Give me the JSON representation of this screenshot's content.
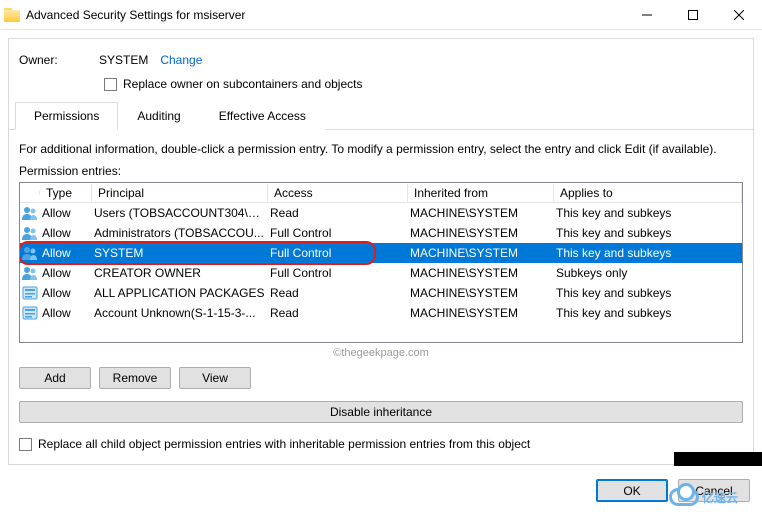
{
  "window": {
    "title": "Advanced Security Settings for msiserver"
  },
  "owner": {
    "label": "Owner:",
    "value": "SYSTEM",
    "change": "Change",
    "replace_checkbox_label": "Replace owner on subcontainers and objects"
  },
  "tabs": {
    "permissions": "Permissions",
    "auditing": "Auditing",
    "effective": "Effective Access"
  },
  "info_text": "For additional information, double-click a permission entry. To modify a permission entry, select the entry and click Edit (if available).",
  "entries_label": "Permission entries:",
  "columns": {
    "type": "Type",
    "principal": "Principal",
    "access": "Access",
    "inherited": "Inherited from",
    "applies": "Applies to"
  },
  "rows": [
    {
      "icon": "users",
      "type": "Allow",
      "principal": "Users (TOBSACCOUNT304\\Us...",
      "access": "Read",
      "inherited": "MACHINE\\SYSTEM",
      "applies": "This key and subkeys",
      "selected": false
    },
    {
      "icon": "users",
      "type": "Allow",
      "principal": "Administrators (TOBSACCOU...",
      "access": "Full Control",
      "inherited": "MACHINE\\SYSTEM",
      "applies": "This key and subkeys",
      "selected": false
    },
    {
      "icon": "users",
      "type": "Allow",
      "principal": "SYSTEM",
      "access": "Full Control",
      "inherited": "MACHINE\\SYSTEM",
      "applies": "This key and subkeys",
      "selected": true,
      "highlight": true
    },
    {
      "icon": "users",
      "type": "Allow",
      "principal": "CREATOR OWNER",
      "access": "Full Control",
      "inherited": "MACHINE\\SYSTEM",
      "applies": "Subkeys only",
      "selected": false
    },
    {
      "icon": "package",
      "type": "Allow",
      "principal": "ALL APPLICATION PACKAGES",
      "access": "Read",
      "inherited": "MACHINE\\SYSTEM",
      "applies": "This key and subkeys",
      "selected": false
    },
    {
      "icon": "package",
      "type": "Allow",
      "principal": "Account Unknown(S-1-15-3-...",
      "access": "Read",
      "inherited": "MACHINE\\SYSTEM",
      "applies": "This key and subkeys",
      "selected": false
    }
  ],
  "watermark": "©thegeekpage.com",
  "buttons": {
    "add": "Add",
    "remove": "Remove",
    "view": "View",
    "disable_inheritance": "Disable inheritance",
    "ok": "OK",
    "cancel": "Cancel"
  },
  "replace_all_label": "Replace all child object permission entries with inheritable permission entries from this object",
  "logo_text": "亿速云"
}
